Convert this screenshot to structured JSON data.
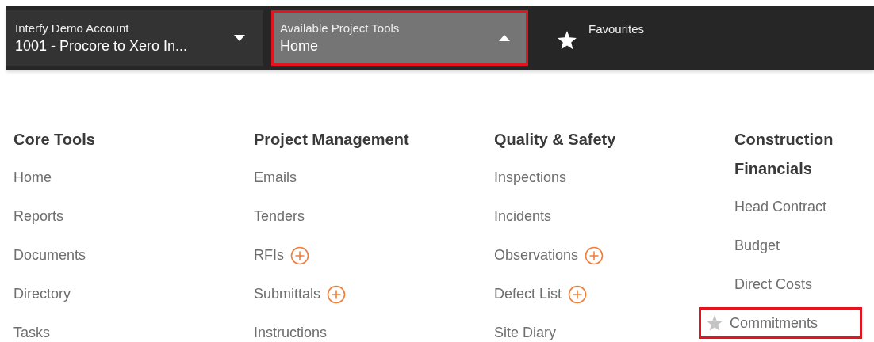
{
  "account": {
    "label": "Interfy Demo Account",
    "value": "1001 - Procore to Xero In..."
  },
  "project_tools": {
    "label": "Available Project Tools",
    "value": "Home",
    "expanded": true,
    "highlighted": true
  },
  "favourites": {
    "label": "Favourites"
  },
  "tool_groups": [
    {
      "title": "Core Tools",
      "items": [
        {
          "label": "Home",
          "add": false,
          "favourite": false,
          "highlighted": false
        },
        {
          "label": "Reports",
          "add": false,
          "favourite": false,
          "highlighted": false
        },
        {
          "label": "Documents",
          "add": false,
          "favourite": false,
          "highlighted": false
        },
        {
          "label": "Directory",
          "add": false,
          "favourite": false,
          "highlighted": false
        },
        {
          "label": "Tasks",
          "add": false,
          "favourite": false,
          "highlighted": false
        }
      ]
    },
    {
      "title": "Project Management",
      "items": [
        {
          "label": "Emails",
          "add": false,
          "favourite": false,
          "highlighted": false
        },
        {
          "label": "Tenders",
          "add": false,
          "favourite": false,
          "highlighted": false
        },
        {
          "label": "RFIs",
          "add": true,
          "favourite": false,
          "highlighted": false
        },
        {
          "label": "Submittals",
          "add": true,
          "favourite": false,
          "highlighted": false
        },
        {
          "label": "Instructions",
          "add": false,
          "favourite": false,
          "highlighted": false
        }
      ]
    },
    {
      "title": "Quality & Safety",
      "items": [
        {
          "label": "Inspections",
          "add": false,
          "favourite": false,
          "highlighted": false
        },
        {
          "label": "Incidents",
          "add": false,
          "favourite": false,
          "highlighted": false
        },
        {
          "label": "Observations",
          "add": true,
          "favourite": false,
          "highlighted": false
        },
        {
          "label": "Defect List",
          "add": true,
          "favourite": false,
          "highlighted": false
        },
        {
          "label": "Site Diary",
          "add": false,
          "favourite": false,
          "highlighted": false
        }
      ]
    },
    {
      "title": "Construction Financials",
      "items": [
        {
          "label": "Head Contract",
          "add": false,
          "favourite": false,
          "highlighted": false
        },
        {
          "label": "Budget",
          "add": false,
          "favourite": false,
          "highlighted": false
        },
        {
          "label": "Direct Costs",
          "add": false,
          "favourite": false,
          "highlighted": false
        },
        {
          "label": "Commitments",
          "add": false,
          "favourite": true,
          "highlighted": true
        }
      ]
    }
  ]
}
